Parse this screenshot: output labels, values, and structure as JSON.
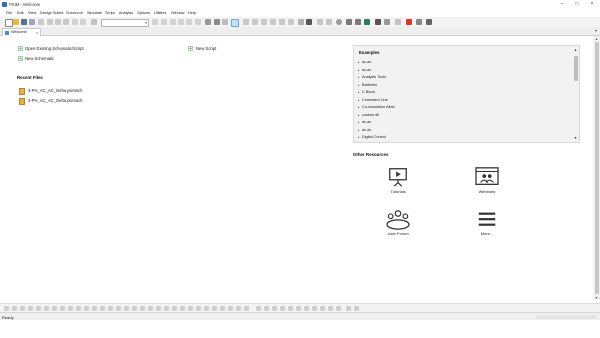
{
  "window": {
    "title": "PSIM - Welcome",
    "controls": [
      "minimize-icon",
      "maximize-icon",
      "close-icon"
    ]
  },
  "menu": [
    "File",
    "Edit",
    "View",
    "Design Suites",
    "Subcircuit",
    "Simulate",
    "Script",
    "Analysis",
    "Options",
    "Utilities",
    "Window",
    "Help"
  ],
  "tab": {
    "label": "Welcome",
    "close": "×"
  },
  "links": {
    "open_existing": "Open Existing Schematic/Script",
    "new_script": "New Script",
    "new_schematic": "New Schematic"
  },
  "recent": {
    "heading": "Recent Files",
    "files": [
      "3-PH_AC_AC_Delta.psimsch",
      "3-PH_AC_AC_Delta.psimsch"
    ]
  },
  "examples": {
    "heading": "Examples",
    "items": [
      "ac-ac",
      "ac-dc",
      "Analysis Tools",
      "Batteries",
      "C Block",
      "Command Line",
      "Co-simulation Altair",
      "custom dll",
      "dc-ac",
      "dc-dc",
      "Digital Control"
    ]
  },
  "other_resources": {
    "heading": "Other Resources",
    "items": [
      {
        "label": "Tutorials",
        "icon": "tutorials-icon"
      },
      {
        "label": "Webinars",
        "icon": "webinars-icon"
      },
      {
        "label": "User Forum",
        "icon": "user-forum-icon"
      },
      {
        "label": "More...",
        "icon": "more-icon"
      }
    ]
  },
  "status": {
    "text": "Ready"
  },
  "colors": {
    "accent_blue": "#2b6fb5",
    "accent_red": "#d83a2a",
    "accent_green": "#3a9a4a",
    "link_green": "#4aa04a"
  }
}
